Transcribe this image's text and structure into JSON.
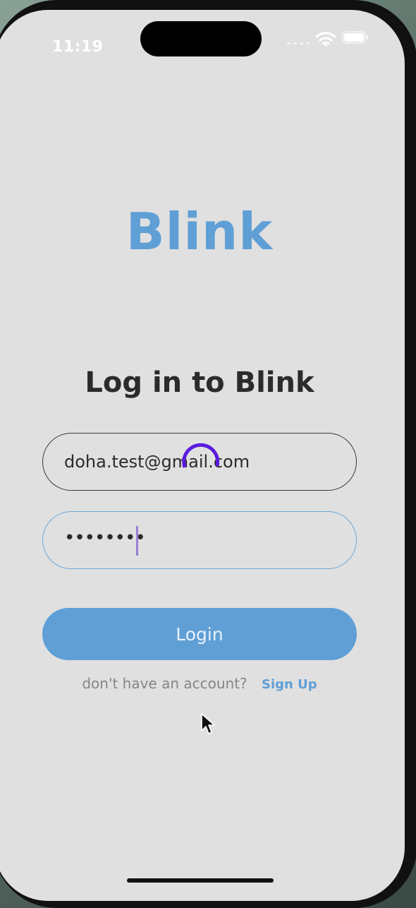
{
  "status_bar": {
    "time": "11:19"
  },
  "app": {
    "logo_text": "Blink",
    "heading": "Log in to Blink"
  },
  "form": {
    "email_value": "doha.test@gmail.com",
    "password_masked": "••••••••",
    "login_label": "Login",
    "signup_prompt": "don't have an account?",
    "signup_link": "Sign Up"
  },
  "state": {
    "loading": true
  },
  "colors": {
    "brand": "#5f9fd6",
    "background": "#e0e0e0",
    "spinner": "#5a1be0"
  },
  "icons": {
    "wifi": "wifi-icon",
    "battery": "battery-icon",
    "spinner": "loading-spinner-icon",
    "cursor": "mouse-pointer-icon"
  }
}
